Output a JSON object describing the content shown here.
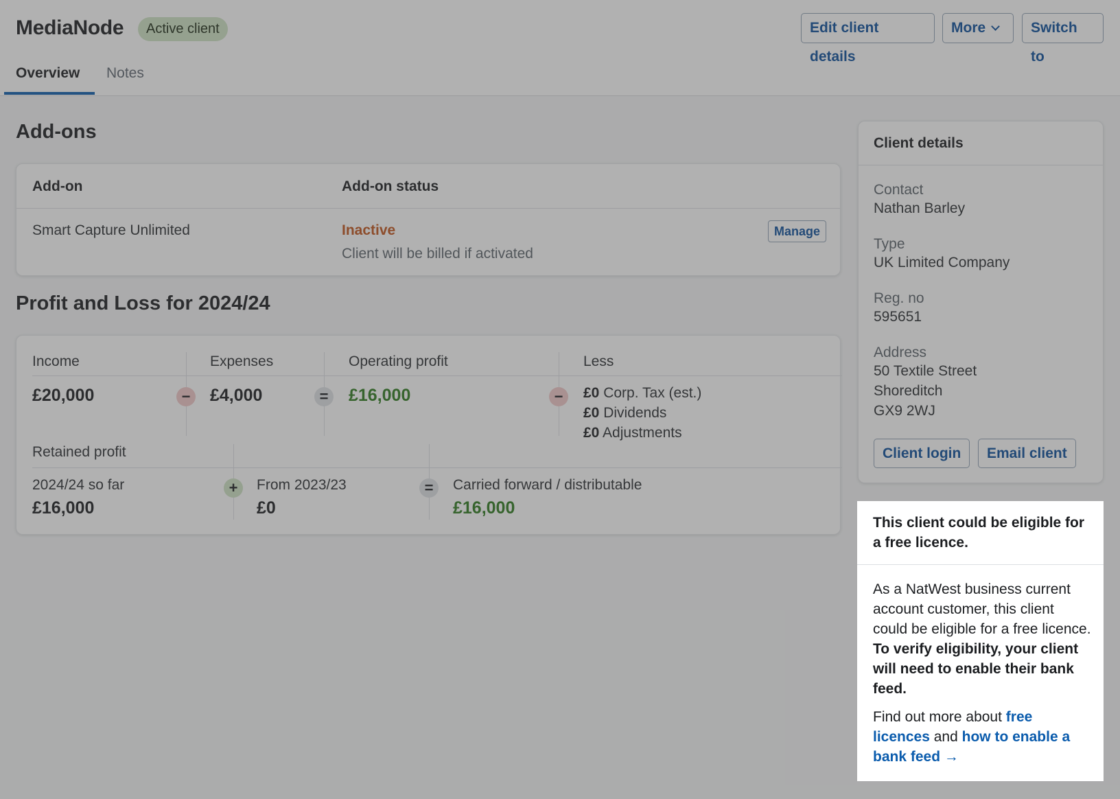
{
  "header": {
    "client_name": "MediaNode",
    "status_badge": "Active client",
    "edit_label": "Edit client details",
    "more_label": "More",
    "switch_label": "Switch to"
  },
  "tabs": [
    {
      "label": "Overview",
      "active": true
    },
    {
      "label": "Notes",
      "active": false
    }
  ],
  "addons": {
    "title": "Add-ons",
    "col_addon": "Add-on",
    "col_status": "Add-on status",
    "rows": [
      {
        "name": "Smart Capture Unlimited",
        "status": "Inactive",
        "note": "Client will be billed if activated",
        "action": "Manage"
      }
    ]
  },
  "pl": {
    "title": "Profit and Loss for 2024/24",
    "income_label": "Income",
    "income_value": "£20,000",
    "expenses_label": "Expenses",
    "expenses_value": "£4,000",
    "operating_label": "Operating profit",
    "operating_value": "£16,000",
    "less_label": "Less",
    "less_items": [
      {
        "amount": "£0",
        "label": "Corp. Tax (est.)"
      },
      {
        "amount": "£0",
        "label": "Dividends"
      },
      {
        "amount": "£0",
        "label": "Adjustments"
      }
    ],
    "retained_label": "Retained profit",
    "so_far_label": "2024/24 so far",
    "so_far_value": "£16,000",
    "from_label": "From 2023/23",
    "from_value": "£0",
    "carried_label": "Carried forward / distributable",
    "carried_value": "£16,000",
    "ops": {
      "minus": "−",
      "equals": "=",
      "plus": "+"
    }
  },
  "details": {
    "title": "Client details",
    "contact_label": "Contact",
    "contact_value": "Nathan Barley",
    "type_label": "Type",
    "type_value": "UK Limited Company",
    "reg_label": "Reg. no",
    "reg_value": "595651",
    "address_label": "Address",
    "address_lines": [
      "50 Textile Street",
      "Shoreditch",
      "GX9 2WJ"
    ],
    "login_label": "Client login",
    "email_label": "Email client"
  },
  "promo": {
    "title": "This client could be eligible for a free licence.",
    "body_plain": "As a NatWest business current account customer, this client could be eligible for a free licence.",
    "body_bold": "To verify eligibility, your client will need to enable their bank feed.",
    "foot_prefix": "Find out more about",
    "foot_link1": "free licences",
    "foot_mid": "and",
    "foot_link2": "how to enable a bank feed →"
  },
  "colors": {
    "accent_blue": "#0b4f9c",
    "positive_green": "#2d7a1e",
    "inactive_orange": "#c2541a",
    "active_badge_bg": "#cfe3c4"
  }
}
